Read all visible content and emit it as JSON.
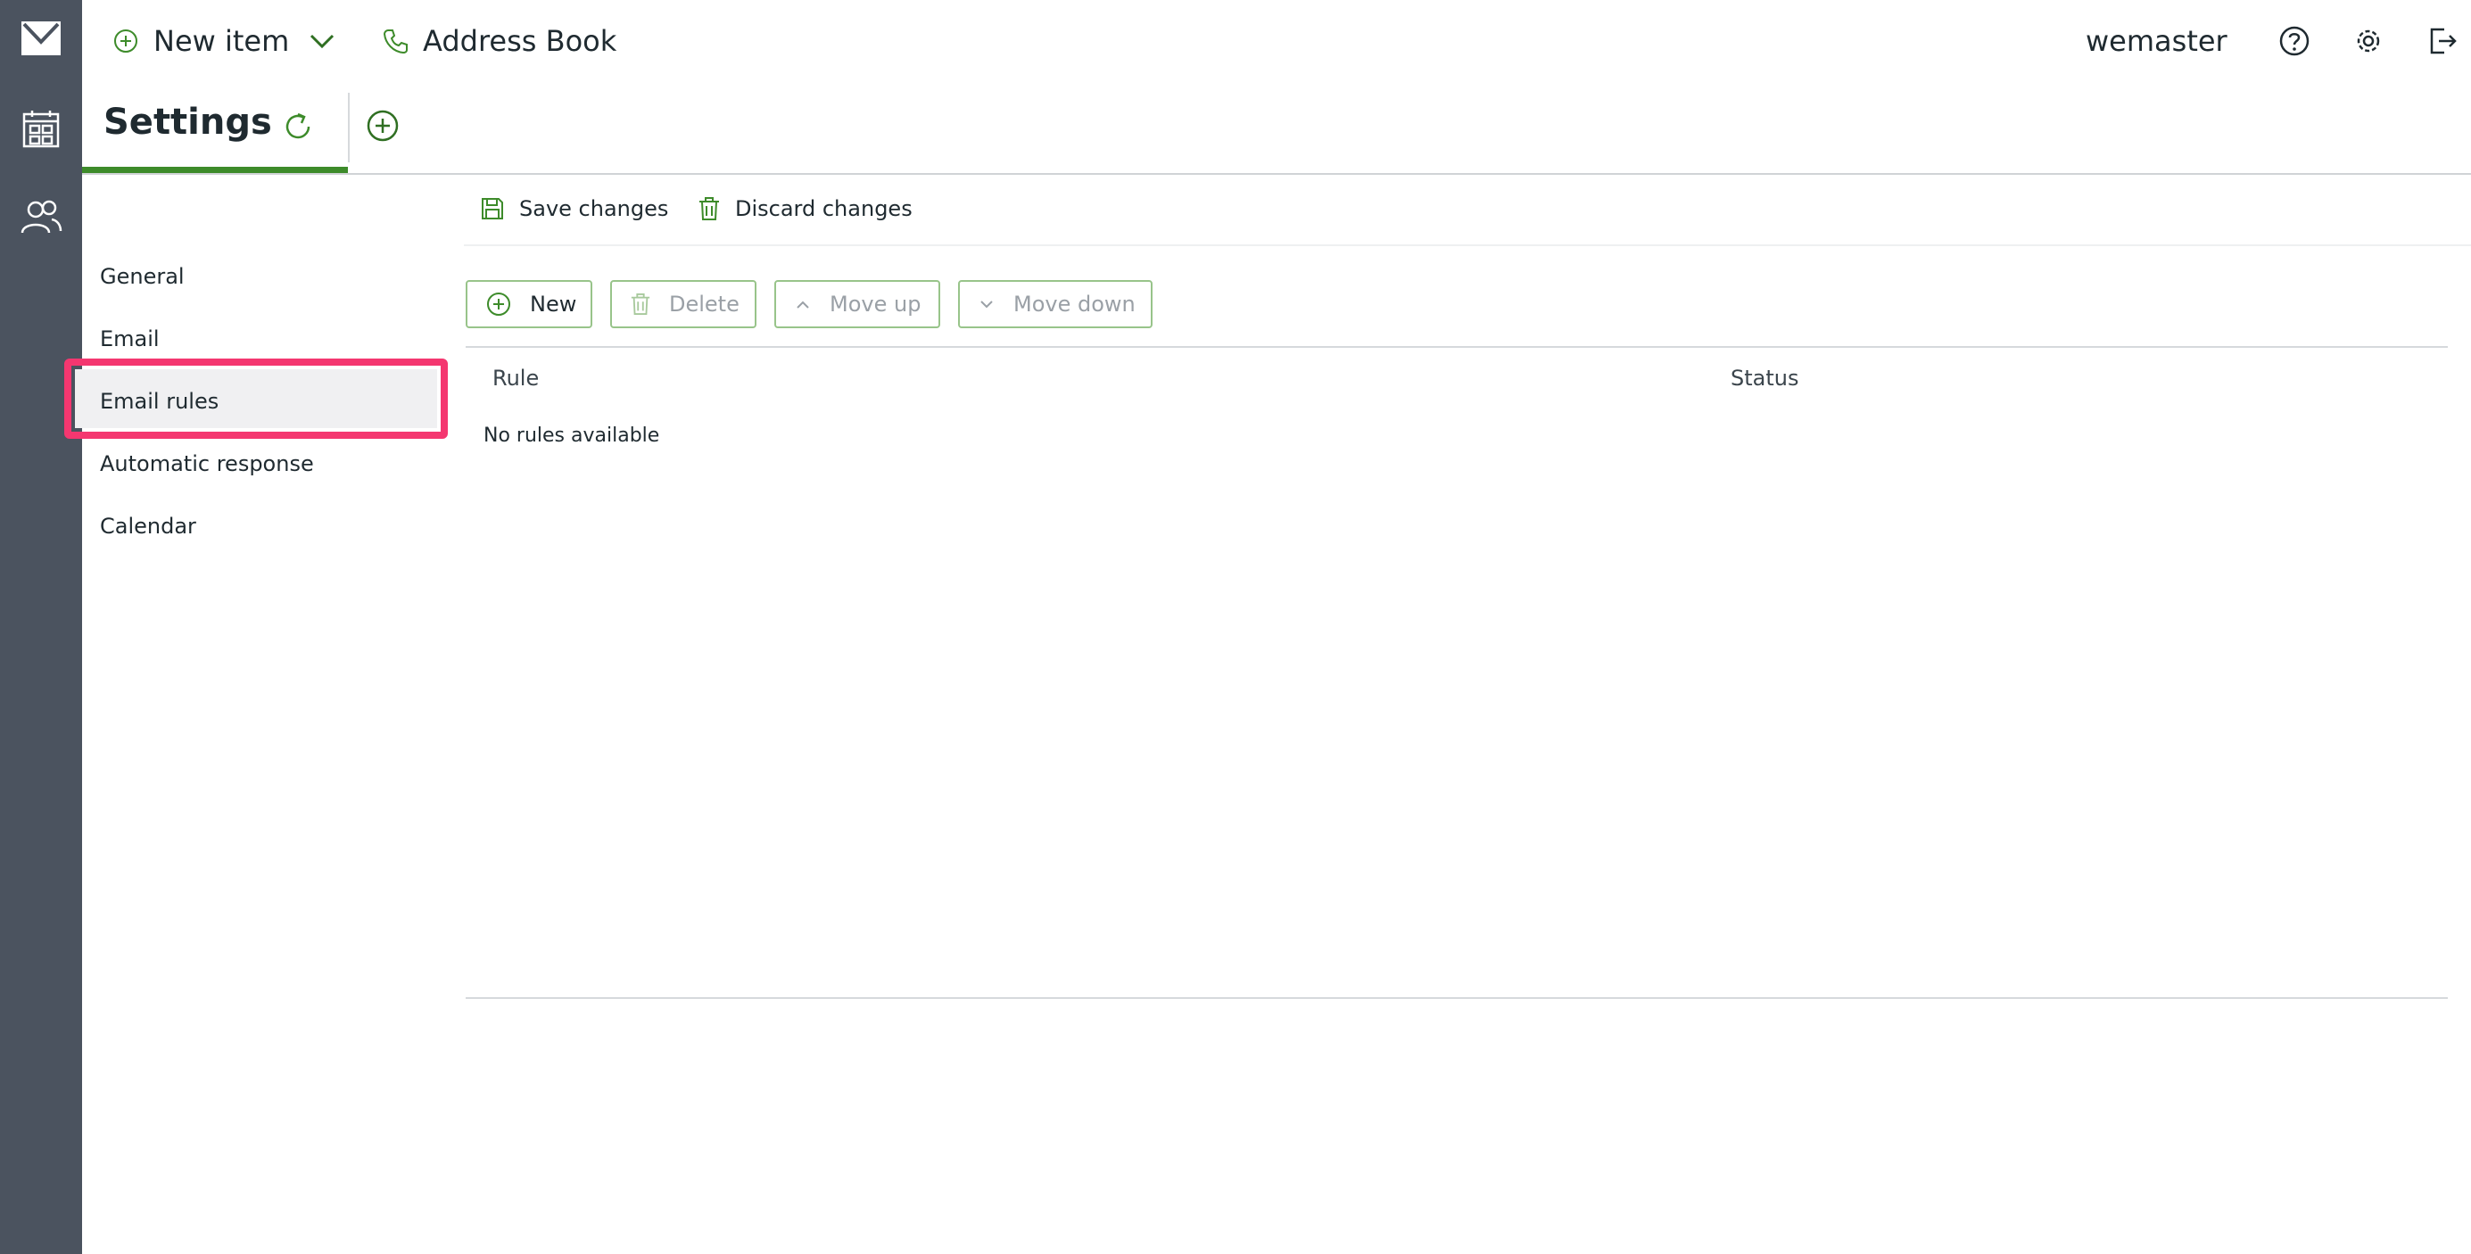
{
  "appbar": {
    "icons": [
      "mail-icon",
      "calendar-icon",
      "contacts-icon"
    ]
  },
  "topbar": {
    "new_item_label": "New item",
    "address_book_label": "Address Book",
    "username": "wemaster"
  },
  "tabs": {
    "active_title": "Settings"
  },
  "sidebar": {
    "items": [
      {
        "label": "General"
      },
      {
        "label": "Email"
      },
      {
        "label": "Email rules"
      },
      {
        "label": "Automatic response"
      },
      {
        "label": "Calendar"
      }
    ],
    "selected": "Email rules"
  },
  "toolbar": {
    "save_label": "Save changes",
    "discard_label": "Discard changes"
  },
  "actions": {
    "new_label": "New",
    "delete_label": "Delete",
    "move_up_label": "Move up",
    "move_down_label": "Move down"
  },
  "table": {
    "columns": [
      "Rule",
      "Status"
    ],
    "empty_message": "No rules available"
  },
  "colors": {
    "accent": "#3d8b2a",
    "highlight": "#f43770",
    "appbar": "#4b535f"
  }
}
